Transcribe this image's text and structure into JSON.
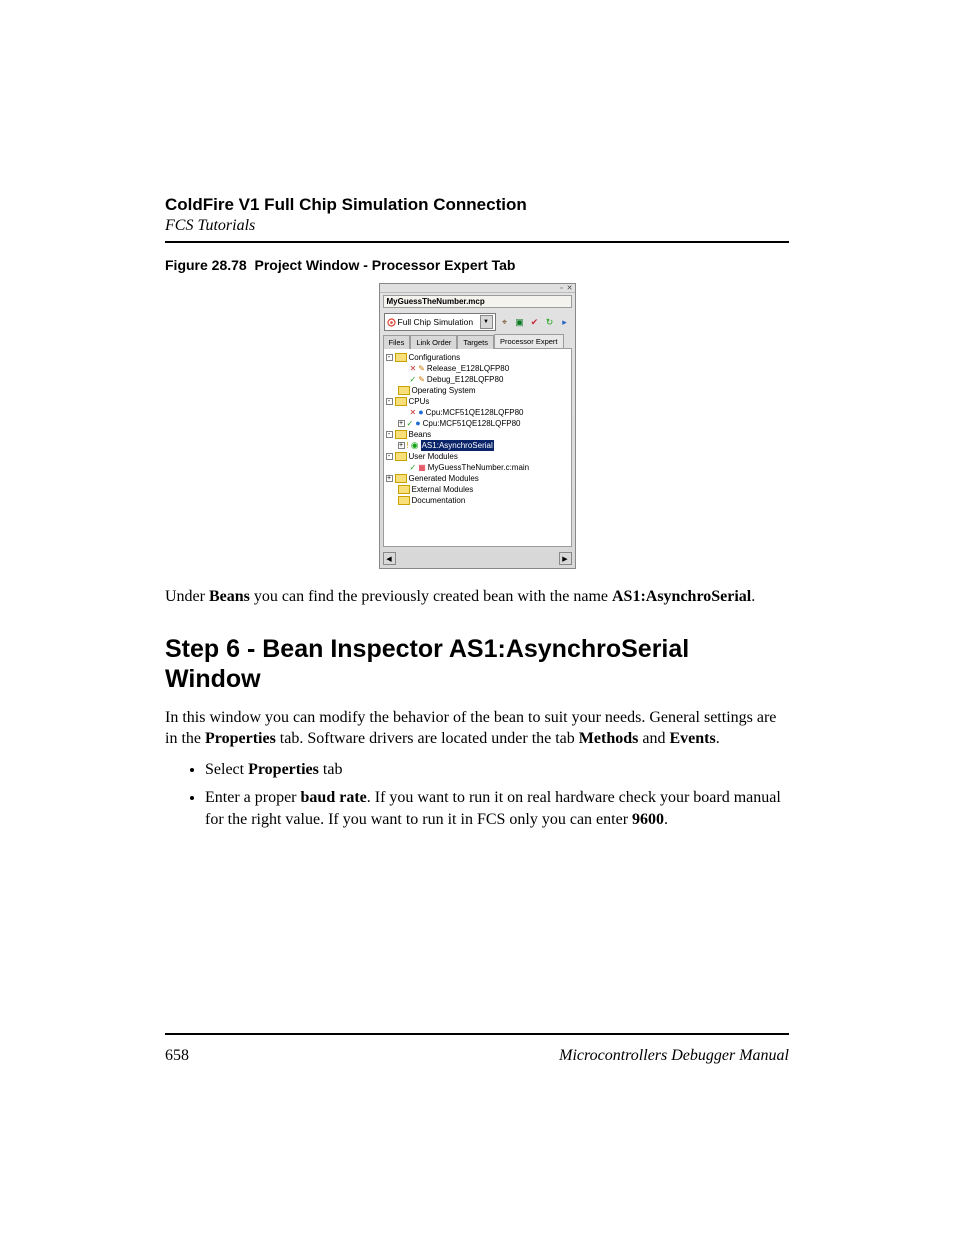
{
  "header": {
    "title": "ColdFire V1 Full Chip Simulation Connection",
    "subtitle": "FCS Tutorials"
  },
  "figure": {
    "caption": "Figure 28.78  Project Window - Processor Expert Tab",
    "window": {
      "projectFile": "MyGuessTheNumber.mcp",
      "targetDropdown": "Full Chip Simulation",
      "tabs": {
        "t1": "Files",
        "t2": "Link Order",
        "t3": "Targets",
        "t4": "Processor Expert"
      },
      "tree": {
        "configurations": "Configurations",
        "release": "Release_E128LQFP80",
        "debug": "Debug_E128LQFP80",
        "os": "Operating System",
        "cpus": "CPUs",
        "cpu1": "Cpu:MCF51QE128LQFP80",
        "cpu2": "Cpu:MCF51QE128LQFP80",
        "beans": "Beans",
        "beanSel": "AS1:AsynchroSerial",
        "userModules": "User Modules",
        "main": "MyGuessTheNumber.c:main",
        "genMod": "Generated Modules",
        "extMod": "External Modules",
        "doc": "Documentation"
      }
    }
  },
  "paragraphs": {
    "p1a": "Under ",
    "p1b": "Beans",
    "p1c": " you can find the previously created bean with the name ",
    "p1d": "AS1:AsynchroSerial",
    "p1e": ".",
    "h2": "Step 6 - Bean Inspector AS1:AsynchroSerial Window",
    "p2a": "In this window you can modify the behavior of the bean to suit your needs. General settings are in the ",
    "p2b": "Properties",
    "p2c": " tab. Software drivers are located under the tab ",
    "p2d": "Methods",
    "p2e": " and ",
    "p2f": "Events",
    "p2g": "."
  },
  "bullets": {
    "b1a": "Select ",
    "b1b": "Properties",
    "b1c": " tab",
    "b2a": "Enter a proper ",
    "b2b": "baud rate",
    "b2c": ". If you want to run it on real hardware check your board manual for the right value. If you want to run it in FCS only you can enter ",
    "b2d": "9600",
    "b2e": "."
  },
  "footer": {
    "pageNum": "658",
    "manual": "Microcontrollers Debugger Manual"
  }
}
